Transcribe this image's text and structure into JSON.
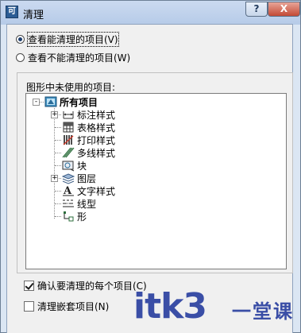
{
  "window": {
    "title": "清理",
    "help_label": "?",
    "close_label": "X",
    "app_icon": "purge-app-icon"
  },
  "view_options": {
    "selected": "purgeable",
    "purgeable": "查看能清理的项目(V)",
    "non_purgeable": "查看不能清理的项目(W)"
  },
  "tree": {
    "label": "图形中未使用的项目:",
    "root": {
      "label": "所有项目",
      "expander": "-",
      "icon": "drawing-root-icon"
    },
    "items": [
      {
        "label": "标注样式",
        "icon": "dimension-style-icon",
        "expander": "+"
      },
      {
        "label": "表格样式",
        "icon": "table-style-icon",
        "expander": ""
      },
      {
        "label": "打印样式",
        "icon": "plot-style-icon",
        "expander": ""
      },
      {
        "label": "多线样式",
        "icon": "multiline-style-icon",
        "expander": ""
      },
      {
        "label": "块",
        "icon": "block-icon",
        "expander": ""
      },
      {
        "label": "图层",
        "icon": "layer-icon",
        "expander": "+"
      },
      {
        "label": "文字样式",
        "icon": "text-style-icon",
        "expander": ""
      },
      {
        "label": "线型",
        "icon": "linetype-icon",
        "expander": ""
      },
      {
        "label": "形",
        "icon": "shape-icon",
        "expander": ""
      }
    ]
  },
  "options": {
    "confirm_each": {
      "label": "确认要清理的每个项目(C)",
      "checked": true
    },
    "purge_nested": {
      "label": "清理嵌套项目(N)",
      "checked": false
    }
  },
  "watermark": {
    "text": "itk3",
    "text_cn": "一堂课"
  }
}
